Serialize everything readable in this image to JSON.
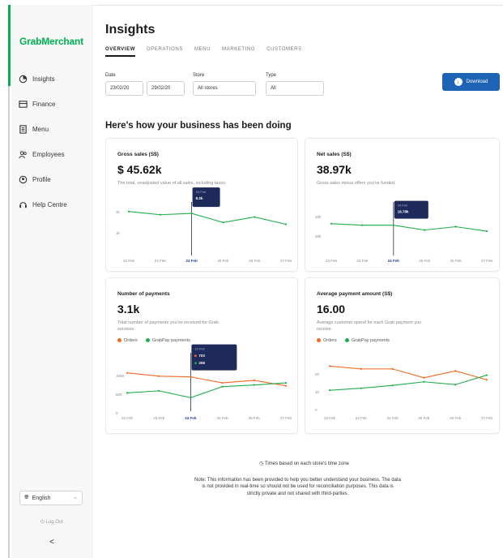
{
  "sidebar": {
    "brand": "GrabMerchant",
    "items": [
      {
        "label": "Insights",
        "icon": "insights-icon"
      },
      {
        "label": "Finance",
        "icon": "finance-icon"
      },
      {
        "label": "Menu",
        "icon": "menu-icon"
      },
      {
        "label": "Employees",
        "icon": "employees-icon"
      },
      {
        "label": "Profile",
        "icon": "profile-icon"
      },
      {
        "label": "Help Centre",
        "icon": "help-icon"
      }
    ],
    "language": "English",
    "logout": "Log Out",
    "collapse": "<"
  },
  "header": {
    "title": "Insights",
    "tabs": [
      "OVERVIEW",
      "OPERATIONS",
      "MENU",
      "MARKETING",
      "CUSTOMERS"
    ],
    "active_tab": "OVERVIEW"
  },
  "filters": {
    "date_label": "Date",
    "date_from": "23/02/20",
    "date_to": "29/02/20",
    "store_label": "Store",
    "store_value": "All stores",
    "type_label": "Type",
    "type_value": "All",
    "download_label": "Download"
  },
  "section_title": "Here's how your business has been doing",
  "colors": {
    "brand": "#00b14f",
    "accent": "#1d63b6",
    "orders": "#f06a22",
    "grabpay": "#1fae4b",
    "tooltip": "#1e2a5a"
  },
  "cards": {
    "gross": {
      "title": "Gross sales (S$)",
      "value": "$ 45.62k",
      "desc": "The total, unadjusted value of all sales, including taxes.",
      "tooltip_date": "24 Feb",
      "tooltip_value": "8.2k"
    },
    "net": {
      "title": "Net sales (S$)",
      "value": "38.97k",
      "desc": "Gross sales minus offers you've funded.",
      "tooltip_date": "24 Feb",
      "tooltip_value": "16.78k"
    },
    "payments": {
      "title": "Number of payments",
      "value": "3.1k",
      "desc": "Total number of payments you've received for Grab services.",
      "legend_orders": "Orders",
      "legend_grabpay": "GrabPay payments",
      "tooltip_date": "24 Feb",
      "tooltip_orders": "703",
      "tooltip_grabpay": "208"
    },
    "average": {
      "title": "Average payment amount (S$)",
      "value": "16.00",
      "desc": "Average customer spend for each Grab payment you receive.",
      "legend_orders": "Orders",
      "legend_grabpay": "GrabPay payments"
    }
  },
  "chart_data": [
    {
      "type": "line",
      "title": "Gross sales (S$)",
      "categories": [
        "22 Feb",
        "23 Feb",
        "24 Feb",
        "25 Feb",
        "26 Feb",
        "27 Feb"
      ],
      "series": [
        {
          "values": [
            8.6,
            7.9,
            8.2,
            6.2,
            7.4,
            5.8
          ]
        }
      ],
      "yticks": [
        "2k",
        "1k"
      ],
      "ylim": [
        0,
        10
      ],
      "highlight": "24 Feb"
    },
    {
      "type": "line",
      "title": "Net sales (S$)",
      "categories": [
        "22 Feb",
        "23 Feb",
        "24 Feb",
        "25 Feb",
        "26 Feb",
        "27 Feb"
      ],
      "series": [
        {
          "values": [
            17.8,
            16.8,
            16.78,
            13.6,
            15.8,
            12.8
          ]
        }
      ],
      "yticks": [
        "10k",
        "20k"
      ],
      "ylim": [
        0,
        30
      ],
      "highlight": "24 Feb"
    },
    {
      "type": "line",
      "title": "Number of payments",
      "categories": [
        "22 Feb",
        "23 Feb",
        "24 Feb",
        "25 Feb",
        "26 Feb",
        "27 Feb"
      ],
      "series": [
        {
          "name": "Orders",
          "values": [
            800,
            720,
            703,
            560,
            620,
            490
          ]
        },
        {
          "name": "GrabPay payments",
          "values": [
            320,
            370,
            208,
            470,
            510,
            560
          ]
        }
      ],
      "yticks": [
        "1000",
        "500",
        "0"
      ],
      "ylim": [
        0,
        1200
      ],
      "highlight": "24 Feb"
    },
    {
      "type": "line",
      "title": "Average payment amount (S$)",
      "categories": [
        "22 Feb",
        "23 Feb",
        "24 Feb",
        "25 Feb",
        "26 Feb",
        "27 Feb"
      ],
      "series": [
        {
          "name": "Orders",
          "values": [
            20,
            18.6,
            18.6,
            14.2,
            17.6,
            13.2
          ]
        },
        {
          "name": "GrabPay payments",
          "values": [
            8,
            9,
            10.4,
            12.2,
            10.8,
            15.5
          ]
        }
      ],
      "yticks": [
        "20",
        "10",
        "0"
      ],
      "ylim": [
        0,
        25
      ]
    }
  ],
  "footer": {
    "timezone": "Times based on each store's time zone",
    "note": "Note: This information has been provided to help you better understand your business. The data is not provided in real-time so should not be used for reconciliation purposes. This data is strictly private and not shared with third-parties."
  }
}
